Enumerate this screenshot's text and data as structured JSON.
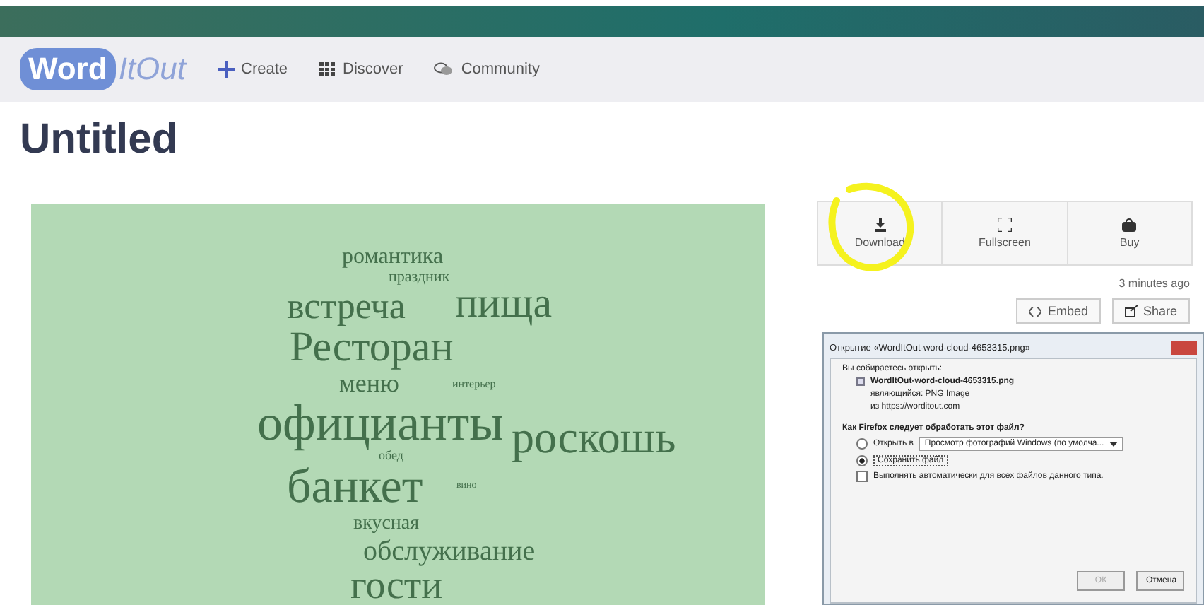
{
  "nav": {
    "logo_highlight": "Word",
    "logo_rest": "ItOut",
    "items": [
      {
        "kind": "create",
        "label": "Create"
      },
      {
        "kind": "discover",
        "label": "Discover"
      },
      {
        "kind": "community",
        "label": "Community"
      }
    ]
  },
  "title": "Untitled",
  "cloud": {
    "words": [
      "романтика",
      "праздник",
      "встреча",
      "пища",
      "Ресторан",
      "меню",
      "интерьер",
      "официанты",
      "обед",
      "роскошь",
      "банкет",
      "вино",
      "вкусная",
      "обслуживание",
      "гости"
    ]
  },
  "actions": [
    {
      "kind": "download",
      "label": "Download",
      "highlighted": true
    },
    {
      "kind": "fullscreen",
      "label": "Fullscreen",
      "highlighted": false
    },
    {
      "kind": "buy",
      "label": "Buy",
      "highlighted": false
    }
  ],
  "time": "3 minutes ago",
  "share_buttons": [
    {
      "kind": "embed",
      "label": "Embed"
    },
    {
      "kind": "share",
      "label": "Share"
    }
  ],
  "dialog": {
    "title": "Открытие «WordItOut-word-cloud-4653315.png»",
    "intro": "Вы собираетесь открыть:",
    "file_name": "WordItOut-word-cloud-4653315.png",
    "file_type": "являющийся: PNG Image",
    "file_source": "из https://worditout.com",
    "question": "Как Firefox следует обработать этот файл?",
    "options": [
      {
        "kind": "open",
        "label": "Открыть в",
        "selected": false,
        "app": "Просмотр фотографий Windows (по умолча..."
      },
      {
        "kind": "save",
        "label": "Сохранить файл",
        "selected": true
      }
    ],
    "remember": {
      "label": "Выполнять автоматически для всех файлов данного типа.",
      "checked": false
    },
    "buttons": [
      {
        "label": "ОК",
        "disabled": true
      },
      {
        "label": "Отмена",
        "disabled": false
      }
    ]
  }
}
